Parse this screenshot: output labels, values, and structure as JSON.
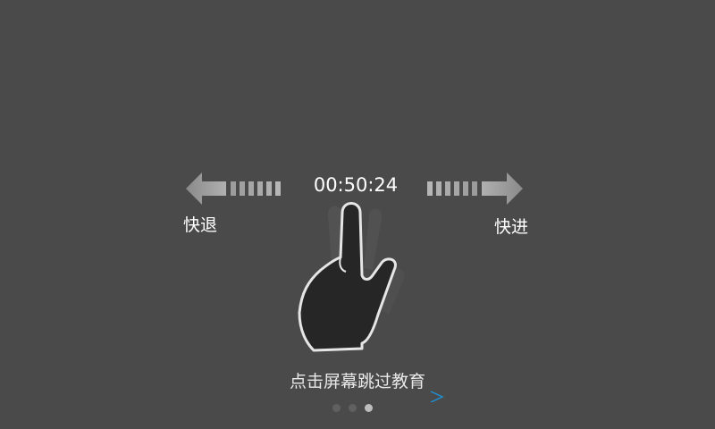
{
  "player": {
    "current_time": "00:50:24",
    "rewind_label": "快退",
    "forward_label": "快进"
  },
  "tutorial": {
    "skip_hint": "点击屏幕跳过教育",
    "page_count": 3,
    "active_page": 3
  },
  "colors": {
    "background": "#4a4a4a",
    "accent_arrow": "#1e8fd0",
    "hand_fill": "#2a2a2a"
  },
  "icons": {
    "left_arrow": "fast-rewind-arrow-icon",
    "right_arrow": "fast-forward-arrow-icon",
    "gesture": "two-finger-swipe-hand-icon"
  }
}
